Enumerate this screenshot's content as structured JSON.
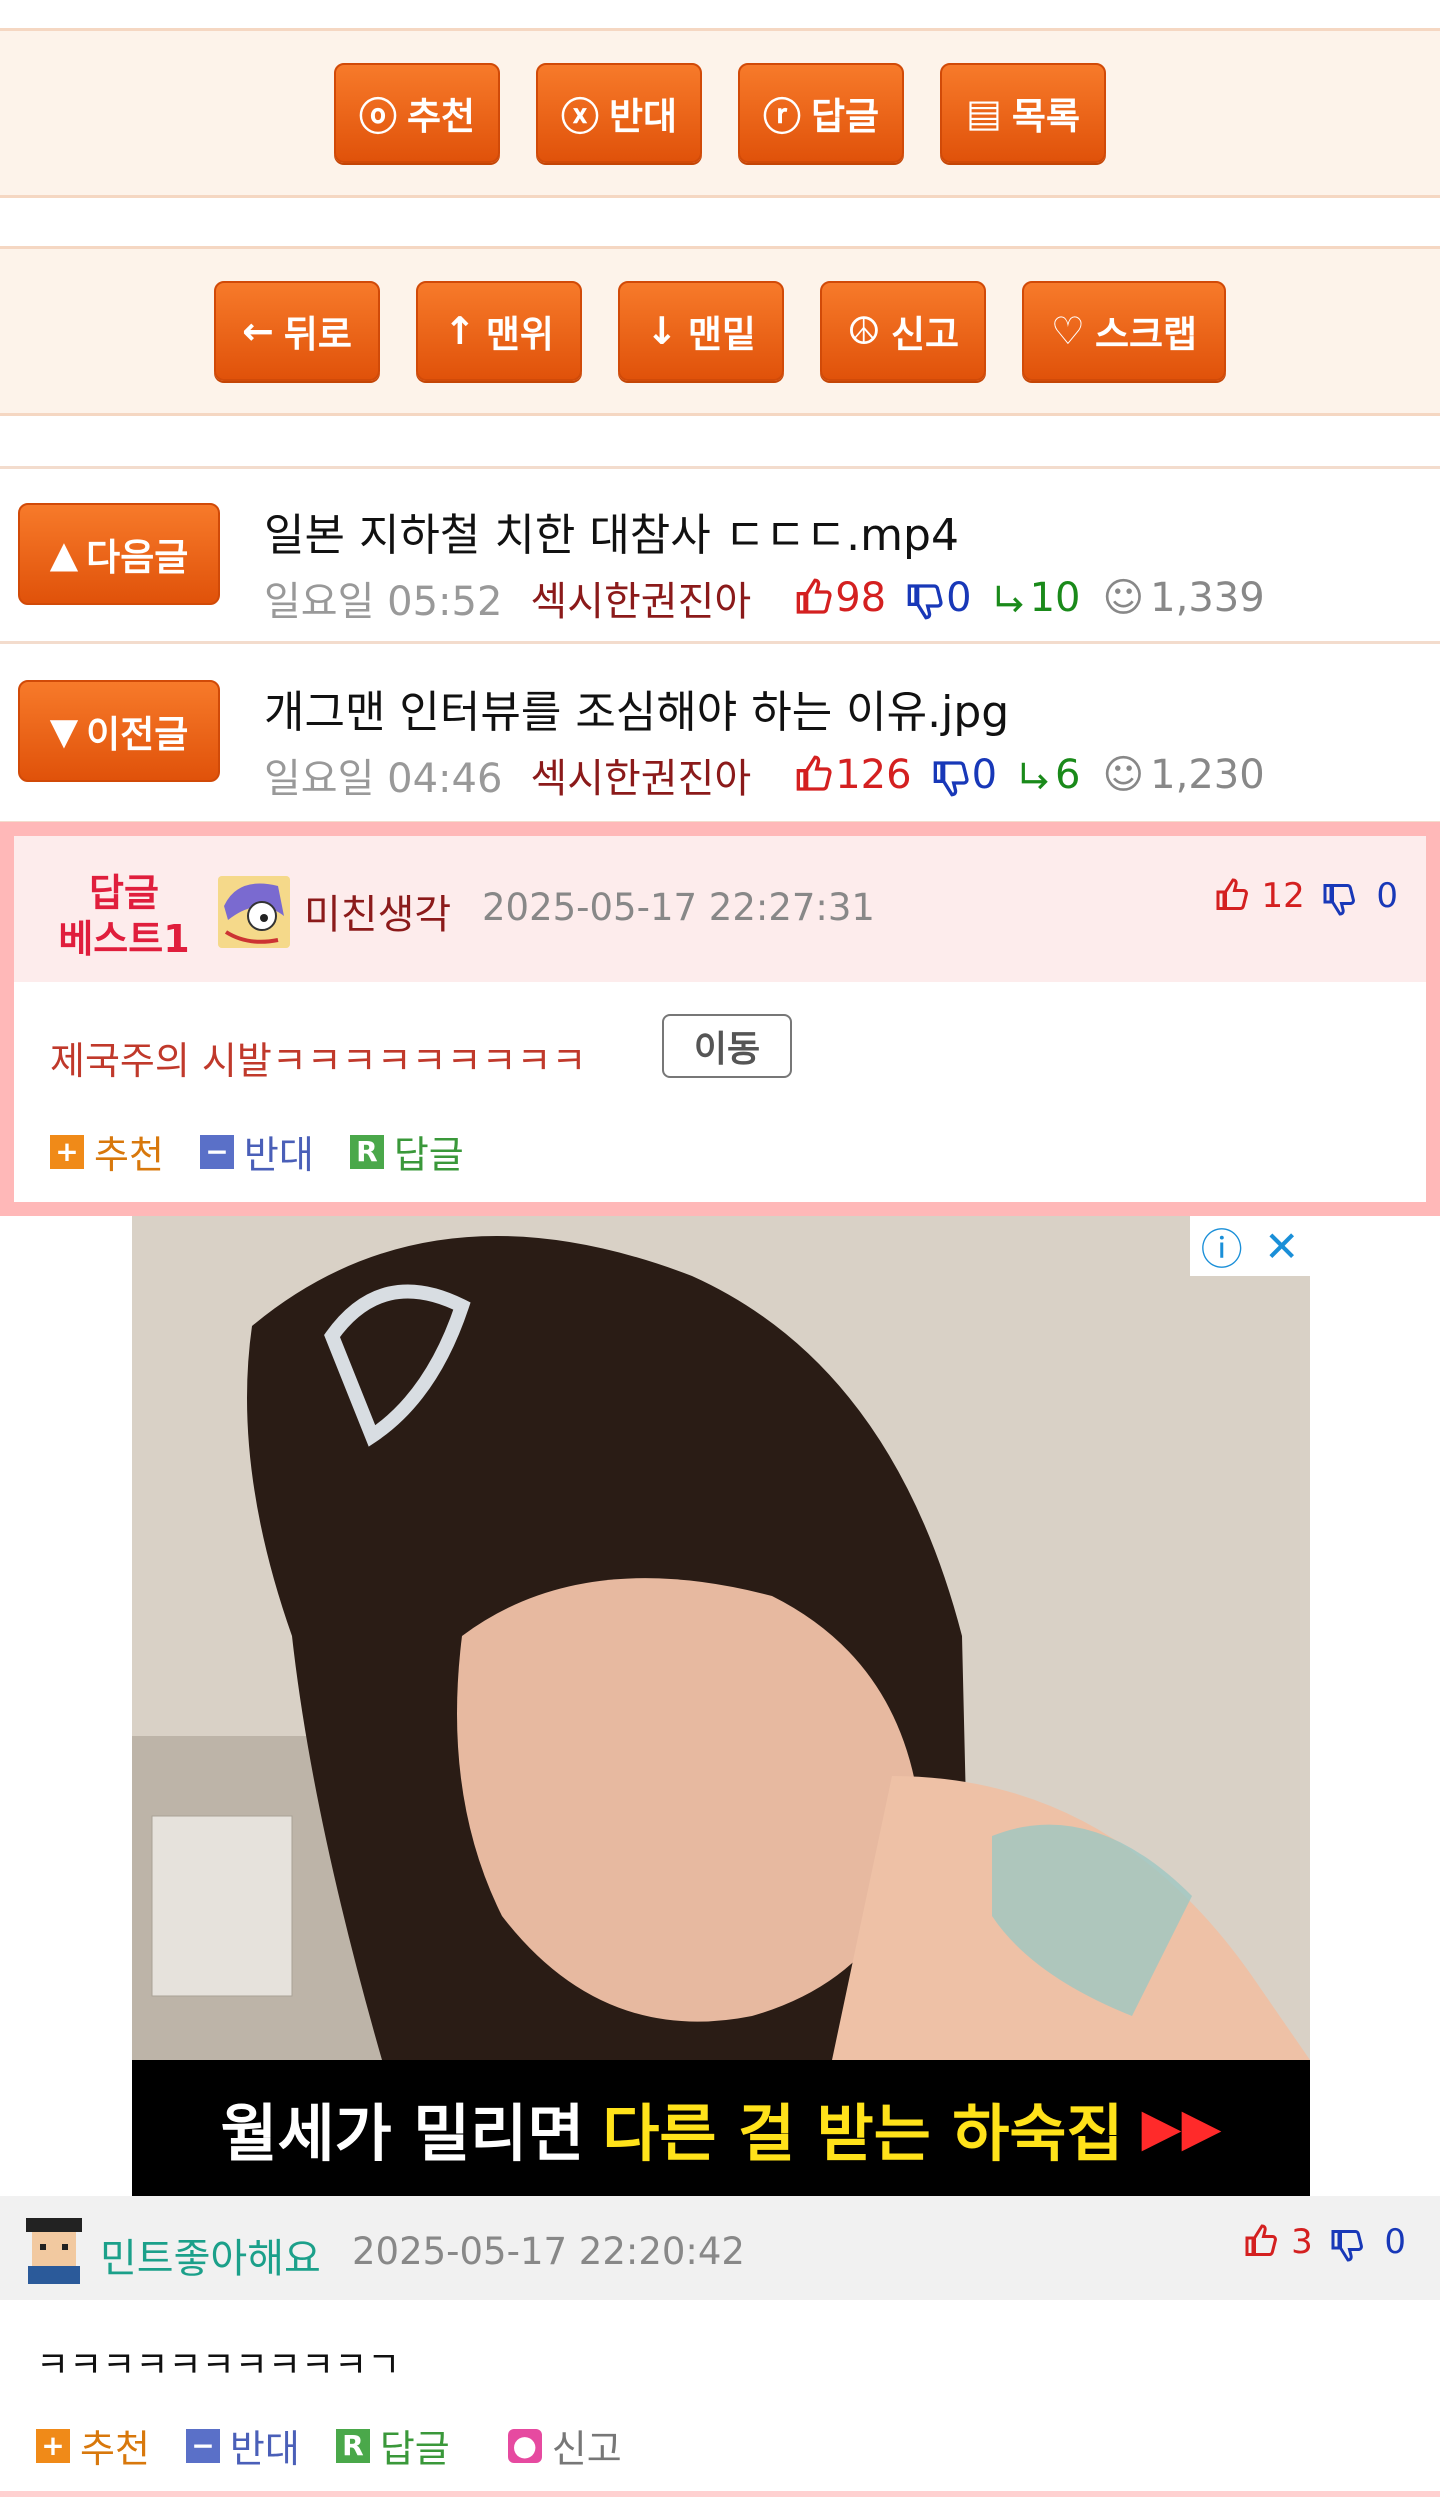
{
  "top_actions": [
    {
      "icon": "ⓞ",
      "icon_name": "recommend-circle-icon",
      "label": "추천"
    },
    {
      "icon": "ⓧ",
      "icon_name": "oppose-circle-icon",
      "label": "반대"
    },
    {
      "icon": "ⓡ",
      "icon_name": "reply-circle-icon",
      "label": "답글"
    },
    {
      "icon": "▤",
      "icon_name": "list-icon",
      "label": "목록"
    }
  ],
  "nav_actions": [
    {
      "icon": "←",
      "icon_name": "arrow-left-icon",
      "label": "뒤로"
    },
    {
      "icon": "↑",
      "icon_name": "arrow-up-icon",
      "label": "맨위"
    },
    {
      "icon": "↓",
      "icon_name": "arrow-down-icon",
      "label": "맨밑"
    },
    {
      "icon": "☮",
      "icon_name": "report-icon",
      "label": "신고"
    },
    {
      "icon": "♡",
      "icon_name": "heart-icon",
      "label": "스크랩"
    }
  ],
  "next_post": {
    "button": "다음글",
    "button_icon": "▲",
    "title": "일본 지하철 치한 대참사 ㄷㄷㄷ.mp4",
    "time": "일요일 05:52",
    "author": "섹시한권진아",
    "up": "98",
    "down": "0",
    "replies": "10",
    "views": "1,339"
  },
  "prev_post": {
    "button": "이전글",
    "button_icon": "▼",
    "title": "개그맨 인터뷰를 조심해야 하는 이유.jpg",
    "time": "일요일 04:46",
    "author": "섹시한권진아",
    "up": "126",
    "down": "0",
    "replies": "6",
    "views": "1,230"
  },
  "best_comment": {
    "label_line1": "답글",
    "label_line2": "베스트1",
    "nickname": "미친생각",
    "datetime": "2025-05-17 22:27:31",
    "up": "12",
    "down": "0",
    "text": "제국주의 시발ㅋㅋㅋㅋㅋㅋㅋㅋㅋ",
    "move_button": "이동",
    "actions": {
      "recommend": "추천",
      "oppose": "반대",
      "reply": "답글"
    }
  },
  "ad": {
    "caption_white": "월세가 밀리면",
    "caption_yellow": "다른 걸 받는 하숙집",
    "caption_arrow": "▶▶",
    "info_icon": "ⓘ",
    "close_icon": "✕"
  },
  "comment2": {
    "nickname": "민트좋아해요",
    "datetime": "2025-05-17 22:20:42",
    "up": "3",
    "down": "0",
    "text": "ㅋㅋㅋㅋㅋㅋㅋㅋㅋㅋㄱ",
    "actions": {
      "recommend": "추천",
      "oppose": "반대",
      "reply": "답글",
      "report": "신고"
    }
  },
  "colors": {
    "accent": "#ee6512",
    "best_border": "#ffb8b8",
    "up": "#d42020",
    "down": "#1838b8",
    "reply": "#1a8a1a"
  }
}
